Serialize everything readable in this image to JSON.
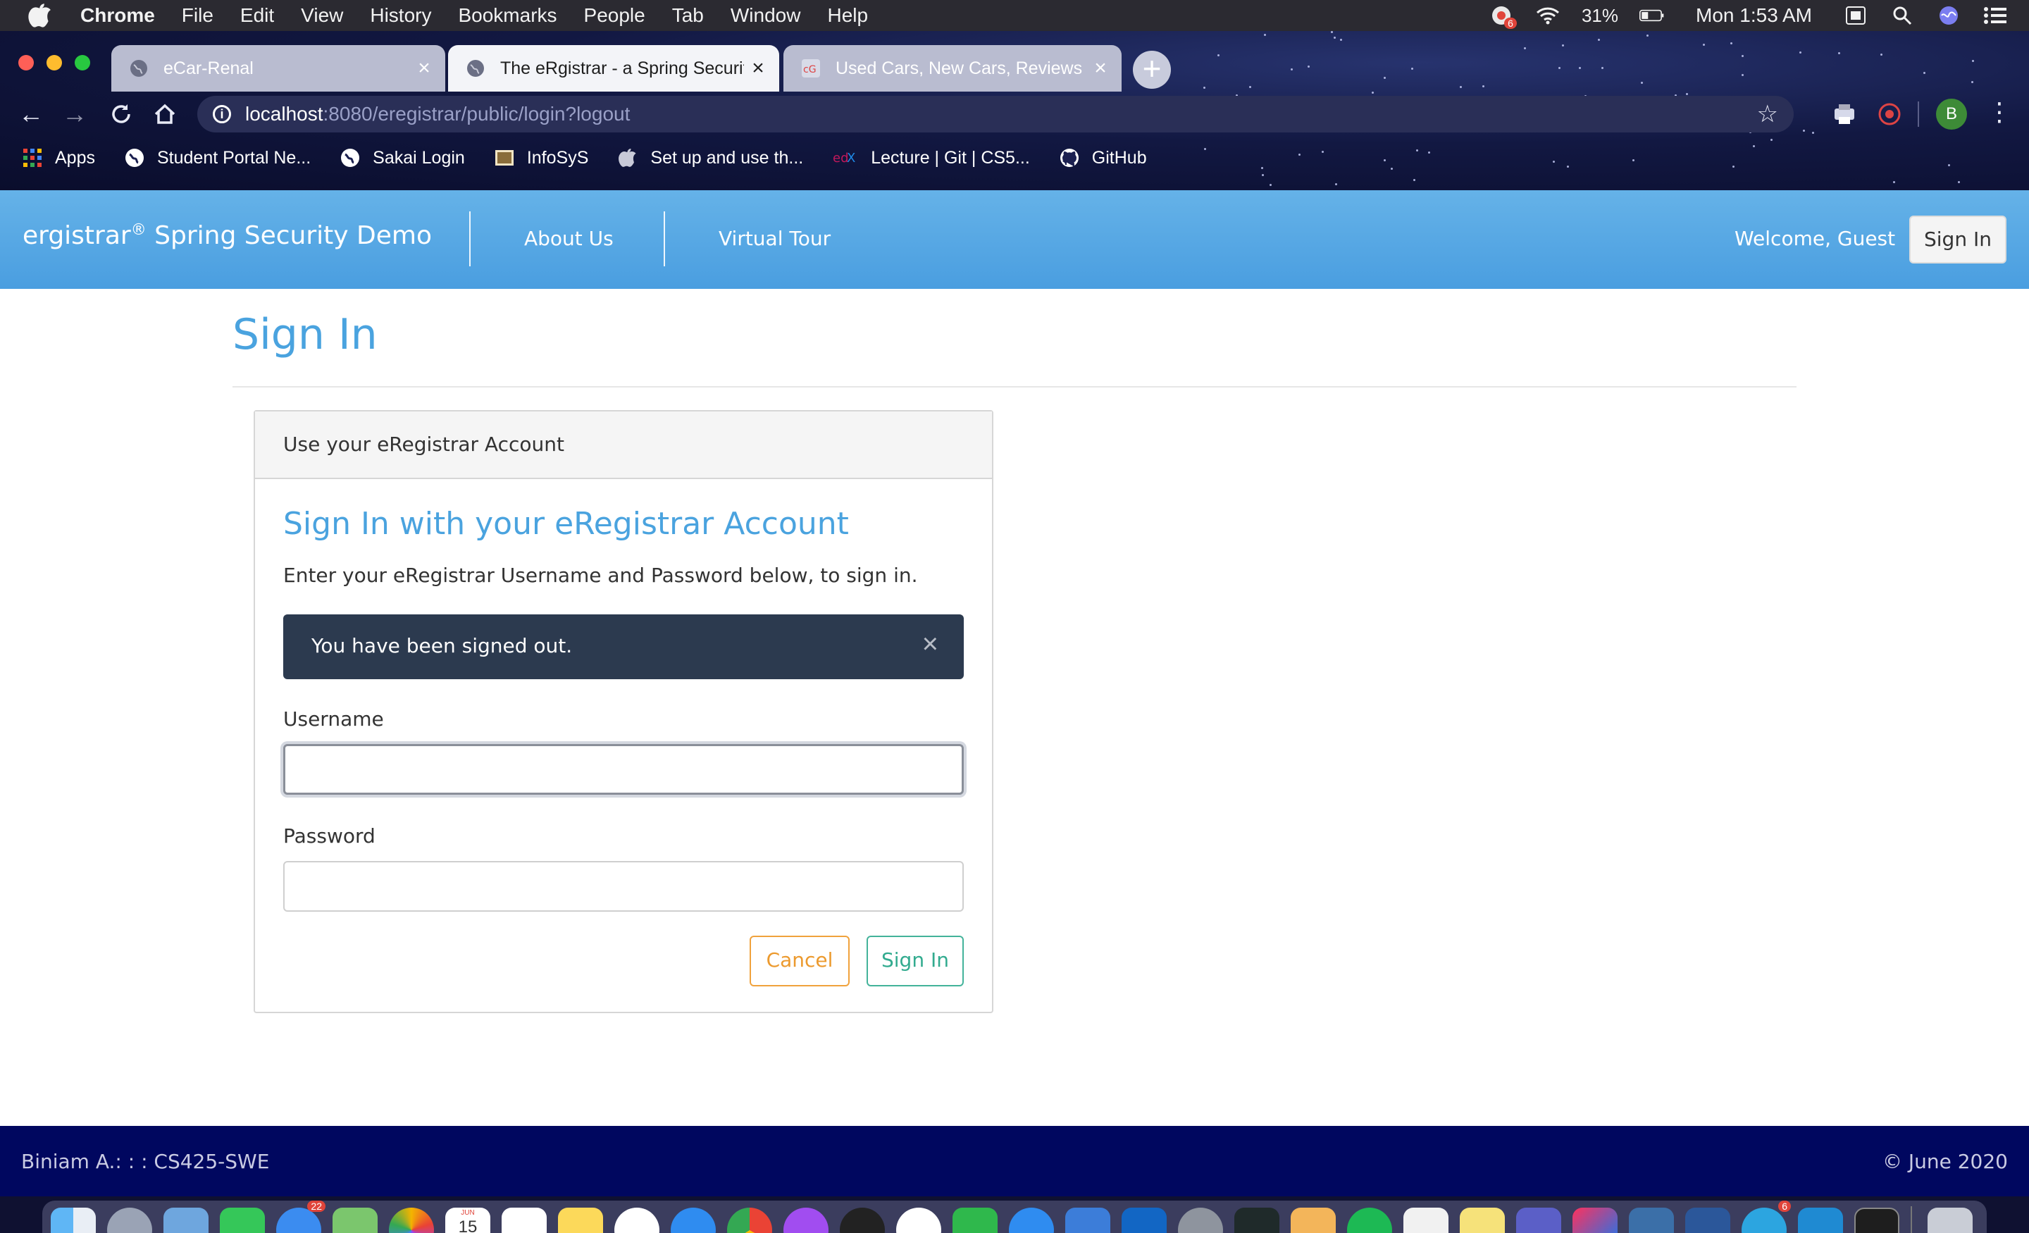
{
  "menubar": {
    "app": "Chrome",
    "items": [
      "File",
      "Edit",
      "View",
      "History",
      "Bookmarks",
      "People",
      "Tab",
      "Window",
      "Help"
    ],
    "notification_badge": "6",
    "battery": "31%",
    "clock": "Mon 1:53 AM"
  },
  "tabs": [
    {
      "title": "eCar-Renal",
      "icon": "globe-icon",
      "active": false
    },
    {
      "title": "The eRgistrar - a Spring Security",
      "icon": "globe-icon",
      "active": true
    },
    {
      "title": "Used Cars, New Cars, Reviews",
      "icon": "cars-favicon",
      "active": false
    }
  ],
  "toolbar": {
    "url_host": "localhost",
    "url_path": ":8080/eregistrar/public/login?logout",
    "profile_initial": "B"
  },
  "bookmarks": [
    {
      "label": "Apps",
      "icon": "apps-grid-icon"
    },
    {
      "label": "Student Portal Ne...",
      "icon": "globe-icon"
    },
    {
      "label": "Sakai Login",
      "icon": "globe-icon"
    },
    {
      "label": "InfoSyS",
      "icon": "infosys-icon"
    },
    {
      "label": "Set up and use th...",
      "icon": "apple-icon"
    },
    {
      "label": "Lecture | Git | CS5...",
      "icon": "edx-icon"
    },
    {
      "label": "GitHub",
      "icon": "github-icon"
    }
  ],
  "navbar": {
    "brand": "ergistrar",
    "brand_mark": "®",
    "brand_suffix": " Spring Security Demo",
    "links": [
      "About Us",
      "Virtual Tour"
    ],
    "welcome": "Welcome, Guest",
    "signin": "Sign In"
  },
  "page": {
    "title": "Sign In"
  },
  "panel": {
    "heading": "Use your eRegistrar Account",
    "title": "Sign In with your eRegistrar Account",
    "description": "Enter your eRegistrar Username and Password below, to sign in.",
    "alert": "You have been signed out.",
    "alert_close": "×",
    "username_label": "Username",
    "username_value": "",
    "password_label": "Password",
    "password_value": "",
    "cancel": "Cancel",
    "submit": "Sign In"
  },
  "footer": {
    "left": "Biniam A.: : : CS425-SWE",
    "right": "© June 2020"
  },
  "dock": {
    "mail_badge": "22",
    "calendar_month": "JUN",
    "calendar_day": "15",
    "telegram_badge": "6"
  },
  "colors": {
    "accent": "#4aa3df",
    "navbar": "#5aa9e4",
    "alert_bg": "#2c3a4f",
    "footer_bg": "#00075f",
    "cancel": "#ec9a2e",
    "submit": "#32ab8f"
  }
}
